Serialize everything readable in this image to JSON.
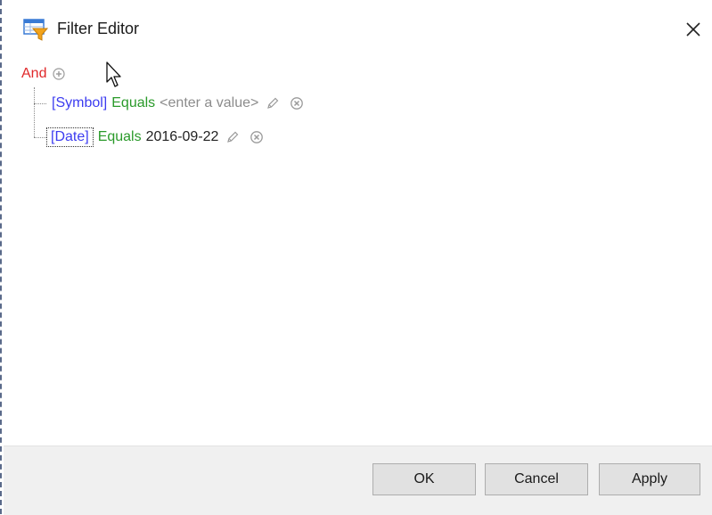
{
  "window": {
    "title": "Filter Editor"
  },
  "filter": {
    "root_operator": "And",
    "conditions": [
      {
        "field": "[Symbol]",
        "operator": "Equals",
        "value": "<enter a value>"
      },
      {
        "field": "[Date]",
        "operator": "Equals",
        "value": "2016-09-22"
      }
    ]
  },
  "buttons": {
    "ok": "OK",
    "cancel": "Cancel",
    "apply": "Apply"
  },
  "icons": {
    "title": "filter-editor-icon",
    "close": "close-icon",
    "add": "add-condition-icon",
    "edit": "pencil-icon",
    "remove": "remove-icon"
  },
  "colors": {
    "group_operator": "#e0282a",
    "field": "#3c3cf0",
    "operator": "#2a9a2a",
    "placeholder": "#8c8c8c"
  }
}
